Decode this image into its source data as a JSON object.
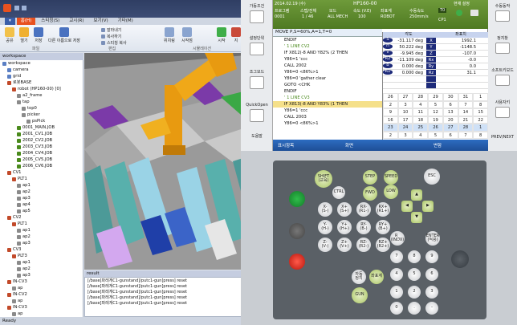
{
  "app": {
    "tabs": [
      "홈(H)",
      "스티칭(S)",
      "교시(R)",
      "보기(V)",
      "기타(M)"
    ],
    "ribbon": {
      "big_buttons": [
        "공유",
        "열기",
        "저장",
        "다른 이름으로 저장",
        "위치링",
        "시작점",
        "시작",
        "지"
      ],
      "small_buttons": [
        "잘라내기",
        "복사하기",
        "스티칭 복사"
      ],
      "groups": [
        "파일",
        "편집",
        "시뮬레이션"
      ]
    },
    "workspace_title": "workspace",
    "tree": [
      {
        "label": "workspace",
        "indent": 0,
        "color": "#5a7fc4"
      },
      {
        "label": "camera",
        "indent": 1,
        "color": "#5a7fc4"
      },
      {
        "label": "grid",
        "indent": 1,
        "color": "#5a7fc4"
      },
      {
        "label": "로봇BASE",
        "indent": 1,
        "color": "#c24a2a"
      },
      {
        "label": "robot (HP160-00) [0]",
        "indent": 2,
        "color": "#c24a2a"
      },
      {
        "label": "a2_frame",
        "indent": 3,
        "color": "#8a8a8a"
      },
      {
        "label": "tap",
        "indent": 3,
        "color": "#8a8a8a"
      },
      {
        "label": "top0",
        "indent": 4,
        "color": "#8a8a8a"
      },
      {
        "label": "picker",
        "indent": 4,
        "color": "#8a8a8a"
      },
      {
        "label": "psPick",
        "indent": 5,
        "color": "#8a8a8a"
      },
      {
        "label": "0001_MAIN.JOB",
        "indent": 3,
        "color": "#4a8a1c"
      },
      {
        "label": "2001_CV1.JOB",
        "indent": 3,
        "color": "#4a8a1c"
      },
      {
        "label": "2002_CV2.JOB",
        "indent": 3,
        "color": "#4a8a1c"
      },
      {
        "label": "2003_CV3.JOB",
        "indent": 3,
        "color": "#4a8a1c"
      },
      {
        "label": "2004_CV4.JOB",
        "indent": 3,
        "color": "#4a8a1c"
      },
      {
        "label": "2005_CV5.JOB",
        "indent": 3,
        "color": "#4a8a1c"
      },
      {
        "label": "2006_CV6.JOB",
        "indent": 3,
        "color": "#4a8a1c"
      },
      {
        "label": "CV1",
        "indent": 1,
        "color": "#c24a2a"
      },
      {
        "label": "PLT1",
        "indent": 2,
        "color": "#c24a2a"
      },
      {
        "label": "ap1",
        "indent": 3,
        "color": "#8a8a8a"
      },
      {
        "label": "ap2",
        "indent": 3,
        "color": "#8a8a8a"
      },
      {
        "label": "ap3",
        "indent": 3,
        "color": "#8a8a8a"
      },
      {
        "label": "ap4",
        "indent": 3,
        "color": "#8a8a8a"
      },
      {
        "label": "ap5",
        "indent": 3,
        "color": "#8a8a8a"
      },
      {
        "label": "CV2",
        "indent": 1,
        "color": "#c24a2a"
      },
      {
        "label": "PLT1",
        "indent": 2,
        "color": "#c24a2a"
      },
      {
        "label": "ap1",
        "indent": 3,
        "color": "#8a8a8a"
      },
      {
        "label": "ap2",
        "indent": 3,
        "color": "#8a8a8a"
      },
      {
        "label": "ap3",
        "indent": 3,
        "color": "#8a8a8a"
      },
      {
        "label": "CV3",
        "indent": 1,
        "color": "#c24a2a"
      },
      {
        "label": "PLT3",
        "indent": 2,
        "color": "#c24a2a"
      },
      {
        "label": "ap1",
        "indent": 3,
        "color": "#8a8a8a"
      },
      {
        "label": "ap2",
        "indent": 3,
        "color": "#8a8a8a"
      },
      {
        "label": "ap3",
        "indent": 3,
        "color": "#8a8a8a"
      },
      {
        "label": "IN-CV3",
        "indent": 1,
        "color": "#c24a2a"
      },
      {
        "label": "ap",
        "indent": 2,
        "color": "#8a8a8a"
      },
      {
        "label": "IN-CV2",
        "indent": 1,
        "color": "#c24a2a"
      },
      {
        "label": "ap",
        "indent": 2,
        "color": "#8a8a8a"
      },
      {
        "label": "IN-CV3",
        "indent": 1,
        "color": "#c24a2a"
      },
      {
        "label": "ap",
        "indent": 2,
        "color": "#8a8a8a"
      }
    ],
    "result_title": "result",
    "result_lines": [
      "[/base]파레게C1-gunstand]/putc1-gun]press] reset",
      "[/base]파레게C1-gunstand]/putc1-gun]press] reset",
      "[/base]파레게C1-gunstand]/putc1-gun]press] reset",
      "[/base]파레게C1-gunstand]/putc1-gun]press] reset",
      "[/base]파레게C1-gunstand]/putc1-gun]press] reset"
    ],
    "status": "Ready"
  },
  "pendant": {
    "left_buttons": [
      "가동조건",
      "설정단위",
      "조그모드",
      "QuickOpen",
      "도움말"
    ],
    "right_buttons": [
      "수동동작",
      "정지창",
      "소프트키보드",
      "사용자키",
      "PREV/NEXT"
    ],
    "top": {
      "date": "2014.02.19 (수)",
      "program_label": "프로그램",
      "program_value": "0001",
      "step_label": "스텝/전체",
      "step_value": "1 / 46",
      "mode_label": "모드",
      "mode_value": "ALL MECH",
      "speed_label": "속도 (V.E)",
      "speed_value": "100",
      "coord_label": "좌표계",
      "coord_value": "ROBOT",
      "jog_label": "수동속도",
      "jog_value": "250mm/s",
      "tool_label": "T0",
      "tool_value": "CP1",
      "robot_name": "HP160-00",
      "title": "현재 설정"
    },
    "program_header": "MOVE P,S=60%,A=1,T=0",
    "program_lines": [
      {
        "text": "ENDIF",
        "cls": ""
      },
      {
        "text": " ",
        "cls": ""
      },
      {
        "text": "' 1 LINE CV2",
        "cls": "g"
      },
      {
        "text": "IF X812(-8 AND Y82% (2 THEN",
        "cls": ""
      },
      {
        "text": "Y86=1 'ccc",
        "cls": ""
      },
      {
        "text": "CALL 2002",
        "cls": ""
      },
      {
        "text": "Y86=0 <86%>1",
        "cls": ""
      },
      {
        "text": "Y86=0 'gather clear",
        "cls": ""
      },
      {
        "text": "GOTO <CHK",
        "cls": ""
      },
      {
        "text": "ENDIF",
        "cls": ""
      },
      {
        "text": " ",
        "cls": ""
      },
      {
        "text": "' 1 LINE CV3",
        "cls": "g"
      },
      {
        "text": "IF X813(-8 AND Y83% (1 THEN",
        "cls": "sel"
      },
      {
        "text": "Y86=1 'ccc",
        "cls": ""
      },
      {
        "text": "CALL 2003",
        "cls": ""
      },
      {
        "text": "Y86=0 <86%>1",
        "cls": ""
      }
    ],
    "var_headers": [
      "각도",
      "",
      "",
      "좌표치"
    ],
    "vars": [
      {
        "k": "S",
        "v": "-31.117 deg",
        "k2": "X",
        "v2": "1992.1"
      },
      {
        "k": "H",
        "v": "50.222 deg",
        "k2": "Y",
        "v2": "-1148.5"
      },
      {
        "k": "V",
        "v": "-9.945 deg",
        "k2": "Z",
        "v2": "-107.0"
      },
      {
        "k": "R2",
        "v": "-11.109 deg",
        "k2": "Rx",
        "v2": "-0.0"
      },
      {
        "k": "B",
        "v": "0.000 deg",
        "k2": "Ry",
        "v2": "0.0"
      },
      {
        "k": "R1",
        "v": "0.000 deg",
        "k2": "Rz",
        "v2": "31.1"
      },
      {
        "k": " ",
        "v": " ",
        "k2": " ",
        "v2": " "
      },
      {
        "k": " ",
        "v": " ",
        "k2": " ",
        "v2": " "
      }
    ],
    "calendar": [
      [
        "26",
        "27",
        "28",
        "29",
        "30",
        "31",
        "1"
      ],
      [
        "2",
        "3",
        "4",
        "5",
        "6",
        "7",
        "8"
      ],
      [
        "9",
        "10",
        "11",
        "12",
        "13",
        "14",
        "15"
      ],
      [
        "16",
        "17",
        "18",
        "19",
        "20",
        "21",
        "22"
      ],
      [
        "23",
        "24",
        "25",
        "26",
        "27",
        "28",
        "1"
      ],
      [
        "2",
        "3",
        "4",
        "5",
        "6",
        "7",
        "8"
      ]
    ],
    "toolbar": {
      "left": "표시항목",
      "middle": "화면",
      "right": "변함"
    },
    "keys": {
      "shift": "SHIFT\n(교육)",
      "ctrl": "CTRL",
      "esc": "ESC",
      "step": "STEP",
      "fwd": "FWD",
      "speed": "SPEED",
      "low": "LOW",
      "x_minus": "X-\n(S-)",
      "x_plus": "X+\n(S+)",
      "rx_minus": "RX-\n(R1-)",
      "rx_plus": "RX+\n(R1+)",
      "y_minus": "Y-\n(H-)",
      "y_plus": "Y+\n(H+)",
      "ry_minus": "RY-\n(B-)",
      "ry_plus": "RY+\n(B+)",
      "z_minus": "Z-\n(V-)",
      "z_plus": "Z+\n(V+)",
      "rz_minus": "RZ-\n(R2-)",
      "rz_plus": "RZ+\n(R2+)",
      "r_index": "R_\n(INDX)",
      "enter": "ENTER\n(적용)",
      "gun": "GUN",
      "jog_label": "자동\n정지",
      "coord": "좌표계",
      "del": "DEL",
      "n7": "7",
      "n8": "8",
      "n9": "9",
      "n4": "4",
      "n5": "5",
      "n6": "6",
      "n1": "1",
      "n2": "2",
      "n3": "3",
      "n0": "0",
      "dot": ".",
      "minus": "-"
    }
  }
}
